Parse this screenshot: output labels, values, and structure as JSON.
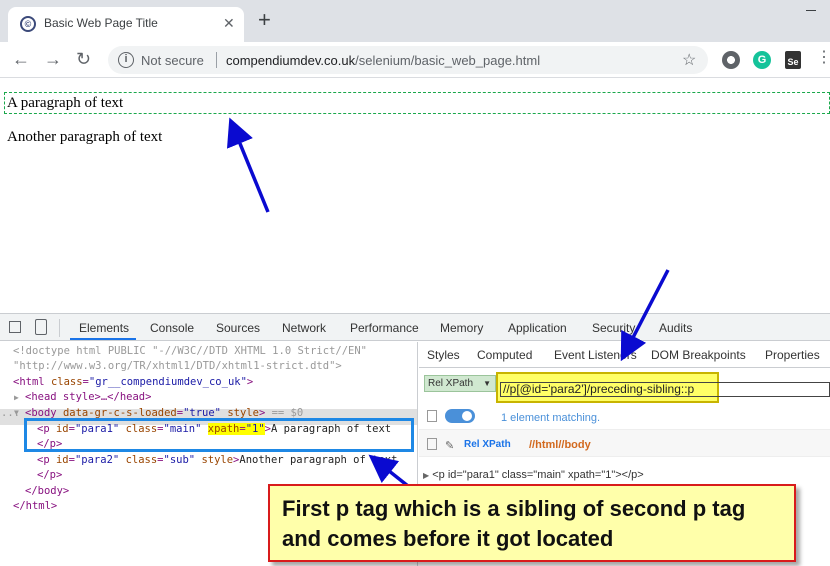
{
  "browser": {
    "tab_title": "Basic Web Page Title",
    "tab_favicon": "©",
    "close_icon": "✕",
    "newtab_icon": "+",
    "security_text": "Not secure",
    "url_host": "compendiumdev.co.uk",
    "url_path": "/selenium/basic_web_page.html",
    "back_icon": "←",
    "forward_icon": "→",
    "reload_icon": "↻",
    "info_icon": "i",
    "star_icon": "☆",
    "grammarly_icon": "G",
    "selenium_icon": "Se",
    "menu_icon": "⋮"
  },
  "page": {
    "para1": "A paragraph of text",
    "para2": "Another paragraph of text"
  },
  "devtools": {
    "tabs": [
      "Elements",
      "Console",
      "Sources",
      "Network",
      "Performance",
      "Memory",
      "Application",
      "Security",
      "Audits"
    ],
    "elements_tree": {
      "doctype_line1": "<!doctype html PUBLIC \"-//W3C//DTD XHTML 1.0 Strict//EN\"",
      "doctype_line2": "\"http://www.w3.org/TR/xhtml1/DTD/xhtml1-strict.dtd\">",
      "html_open_tag": "<html",
      "html_attr_name": "class",
      "html_attr_value": "\"gr__compendiumdev_co_uk\"",
      "html_close_bracket": ">",
      "head_line": "<head style>…</head>",
      "body_open_tag": "<body",
      "body_attr1_name": "data-gr-c-s-loaded",
      "body_attr1_value": "\"true\"",
      "body_attr2_name": "style",
      "body_close_bracket": ">",
      "body_eq": " == $0",
      "p1_tag": "<p",
      "p1_id_name": "id",
      "p1_id_value": "\"para1\"",
      "p1_class_name": "class",
      "p1_class_value": "\"main\"",
      "p1_xpath_name": "xpath",
      "p1_xpath_value": "\"1\"",
      "p1_close_bracket": ">",
      "p1_text": "A paragraph of text",
      "p1_close": "</p>",
      "p2_tag": "<p",
      "p2_id_name": "id",
      "p2_id_value": "\"para2\"",
      "p2_class_name": "class",
      "p2_class_value": "\"sub\"",
      "p2_style_name": "style",
      "p2_close_bracket": ">",
      "p2_text": "Another paragraph of text",
      "p2_close": "</p>",
      "body_close": "</body>",
      "html_close": "</html>",
      "ellipsis": "...",
      "triangle_right": "▶",
      "triangle_down": "▼"
    },
    "sidebar_tabs": [
      "Styles",
      "Computed",
      "Event Listeners",
      "DOM Breakpoints",
      "Properties"
    ],
    "selectors_hub": {
      "mode_select": "Rel XPath",
      "mode_arrow": "▼",
      "xpath_value": "//p[@id='para2']/preceding-sibling::p",
      "matching_text": "1 element matching.",
      "rel_xpath_label": "Rel XPath",
      "abs_path": "//html//body",
      "result_line": "<p id=\"para1\" class=\"main\" xpath=\"1\"></p>",
      "pencil_icon": "✎"
    }
  },
  "annotation": {
    "callout_text": "First p tag which is a sibling of second p tag and comes before it got located"
  },
  "colors": {
    "arrow": "#0a0ad0",
    "callout_border": "#d81b1b",
    "callout_bg": "#ffffaa",
    "highlight_yellow": "#ffff00",
    "selected_box": "#1e88e5"
  }
}
